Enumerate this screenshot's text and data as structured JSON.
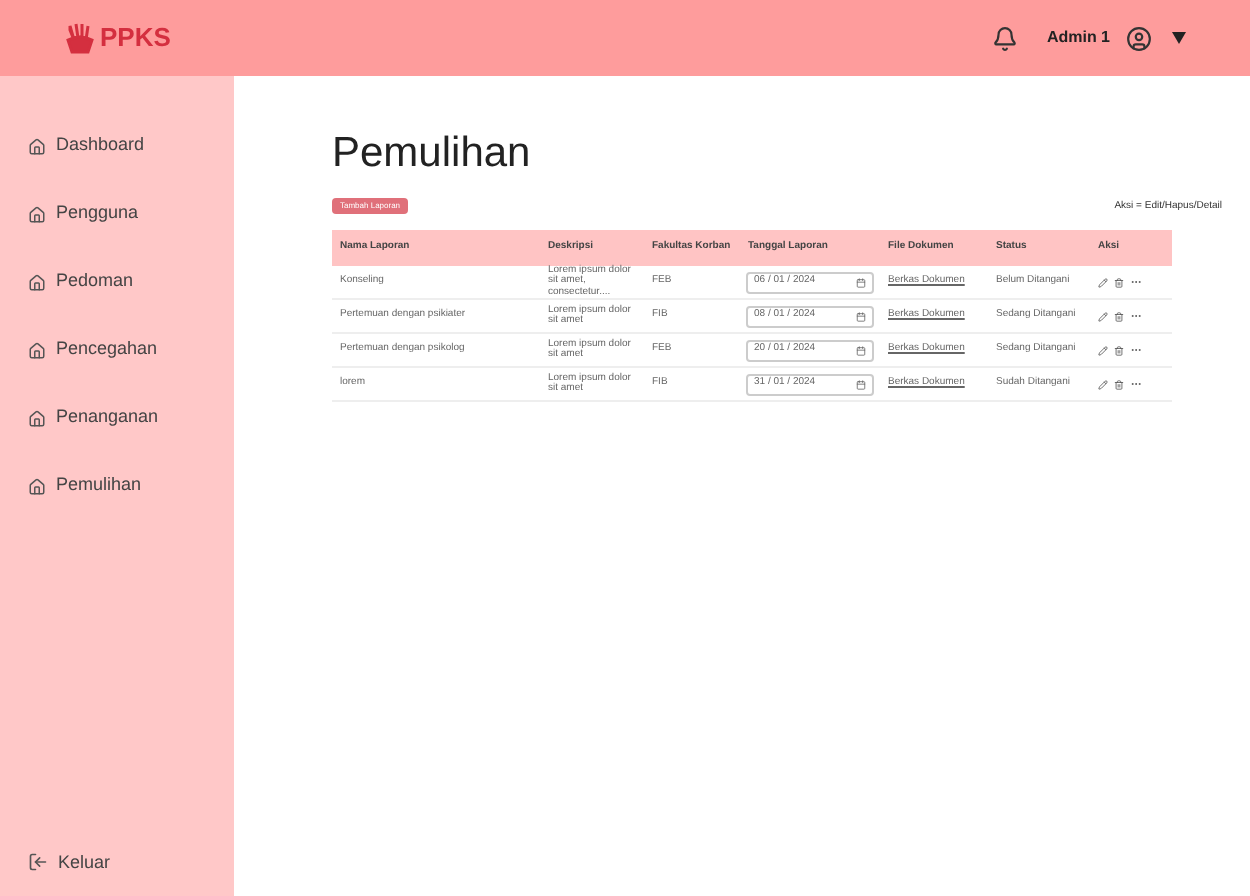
{
  "header": {
    "logo": "PPKS",
    "user": "Admin 1"
  },
  "sidebar": {
    "items": [
      {
        "label": "Dashboard"
      },
      {
        "label": "Pengguna"
      },
      {
        "label": "Pedoman"
      },
      {
        "label": "Pencegahan"
      },
      {
        "label": "Penanganan"
      },
      {
        "label": "Pemulihan"
      }
    ],
    "logout": "Keluar"
  },
  "page": {
    "title": "Pemulihan",
    "add_button": "Tambah Laporan",
    "legend": "Aksi = Edit/Hapus/Detail"
  },
  "table": {
    "columns": [
      "Nama Laporan",
      "Deskripsi",
      "Fakultas Korban",
      "Tanggal Laporan",
      "File Dokumen",
      "Status",
      "Aksi"
    ],
    "rows": [
      {
        "name": "Konseling",
        "description": "Lorem ipsum dolor sit amet, consectetur....",
        "faculty": "FEB",
        "date": "06 / 01 / 2024",
        "file": "Berkas Dokumen",
        "status": "Belum Ditangani"
      },
      {
        "name": "Pertemuan dengan psikiater",
        "description": "Lorem ipsum dolor sit amet",
        "faculty": "FIB",
        "date": "08 / 01 / 2024",
        "file": "Berkas Dokumen",
        "status": "Sedang Ditangani"
      },
      {
        "name": "Pertemuan dengan psikolog",
        "description": "Lorem ipsum dolor sit amet",
        "faculty": "FEB",
        "date": "20 / 01 / 2024",
        "file": "Berkas Dokumen",
        "status": "Sedang Ditangani"
      },
      {
        "name": "lorem",
        "description": "Lorem ipsum dolor sit amet",
        "faculty": "FIB",
        "date": "31 / 01 / 2024",
        "file": "Berkas Dokumen",
        "status": "Sudah Ditangani"
      }
    ]
  }
}
